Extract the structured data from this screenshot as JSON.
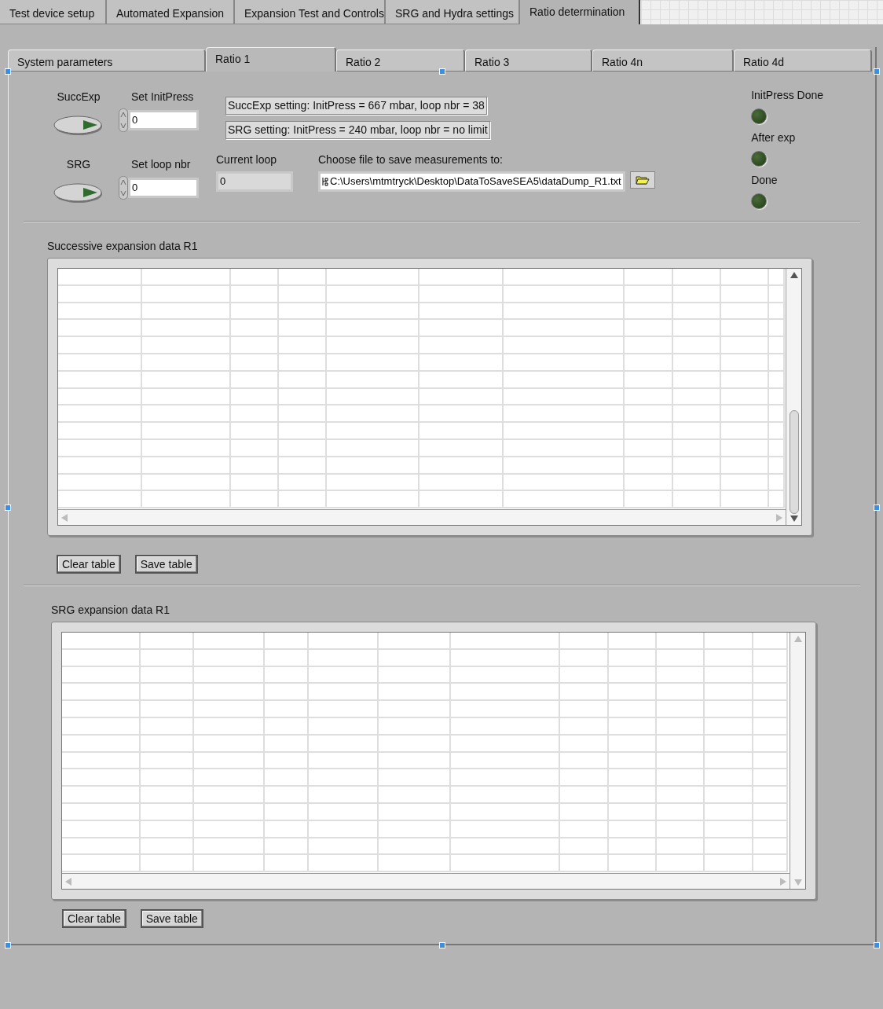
{
  "tabs": [
    {
      "label": "Test device setup",
      "selected": false
    },
    {
      "label": "Automated Expansion",
      "selected": false
    },
    {
      "label": "Expansion Test and Controls",
      "selected": false
    },
    {
      "label": "SRG and Hydra settings",
      "selected": false
    },
    {
      "label": "Ratio determination",
      "selected": true
    }
  ],
  "subtabs": [
    {
      "label": "System parameters",
      "selected": false
    },
    {
      "label": "Ratio 1",
      "selected": true
    },
    {
      "label": "Ratio 2",
      "selected": false
    },
    {
      "label": "Ratio 3",
      "selected": false
    },
    {
      "label": "Ratio 4n",
      "selected": false
    },
    {
      "label": "Ratio 4d",
      "selected": false
    }
  ],
  "switches": [
    {
      "label": "SuccExp",
      "on": false
    },
    {
      "label": "SRG",
      "on": false
    }
  ],
  "numerics": [
    {
      "label": "Set InitPress",
      "value": "0"
    },
    {
      "label": "Set loop nbr",
      "value": "0"
    }
  ],
  "current_loop": {
    "label": "Current loop",
    "value": "0"
  },
  "settings": [
    "SuccExp setting: InitPress = 667 mbar, loop nbr = 38",
    "SRG setting: InitPress = 240 mbar, loop nbr = no limit"
  ],
  "file": {
    "label": "Choose file to save measurements to:",
    "value": "C:\\Users\\mtmtryck\\Desktop\\DataToSaveSEA5\\dataDump_R1.txt"
  },
  "leds": [
    {
      "label": "InitPress Done",
      "on": false
    },
    {
      "label": "After exp",
      "on": false
    },
    {
      "label": "Done",
      "on": false
    }
  ],
  "tables": [
    {
      "title": "Successive expansion data R1",
      "buttons": [
        "Clear table",
        "Save table"
      ]
    },
    {
      "title": "SRG expansion data R1",
      "buttons": [
        "Clear table",
        "Save table"
      ]
    }
  ]
}
